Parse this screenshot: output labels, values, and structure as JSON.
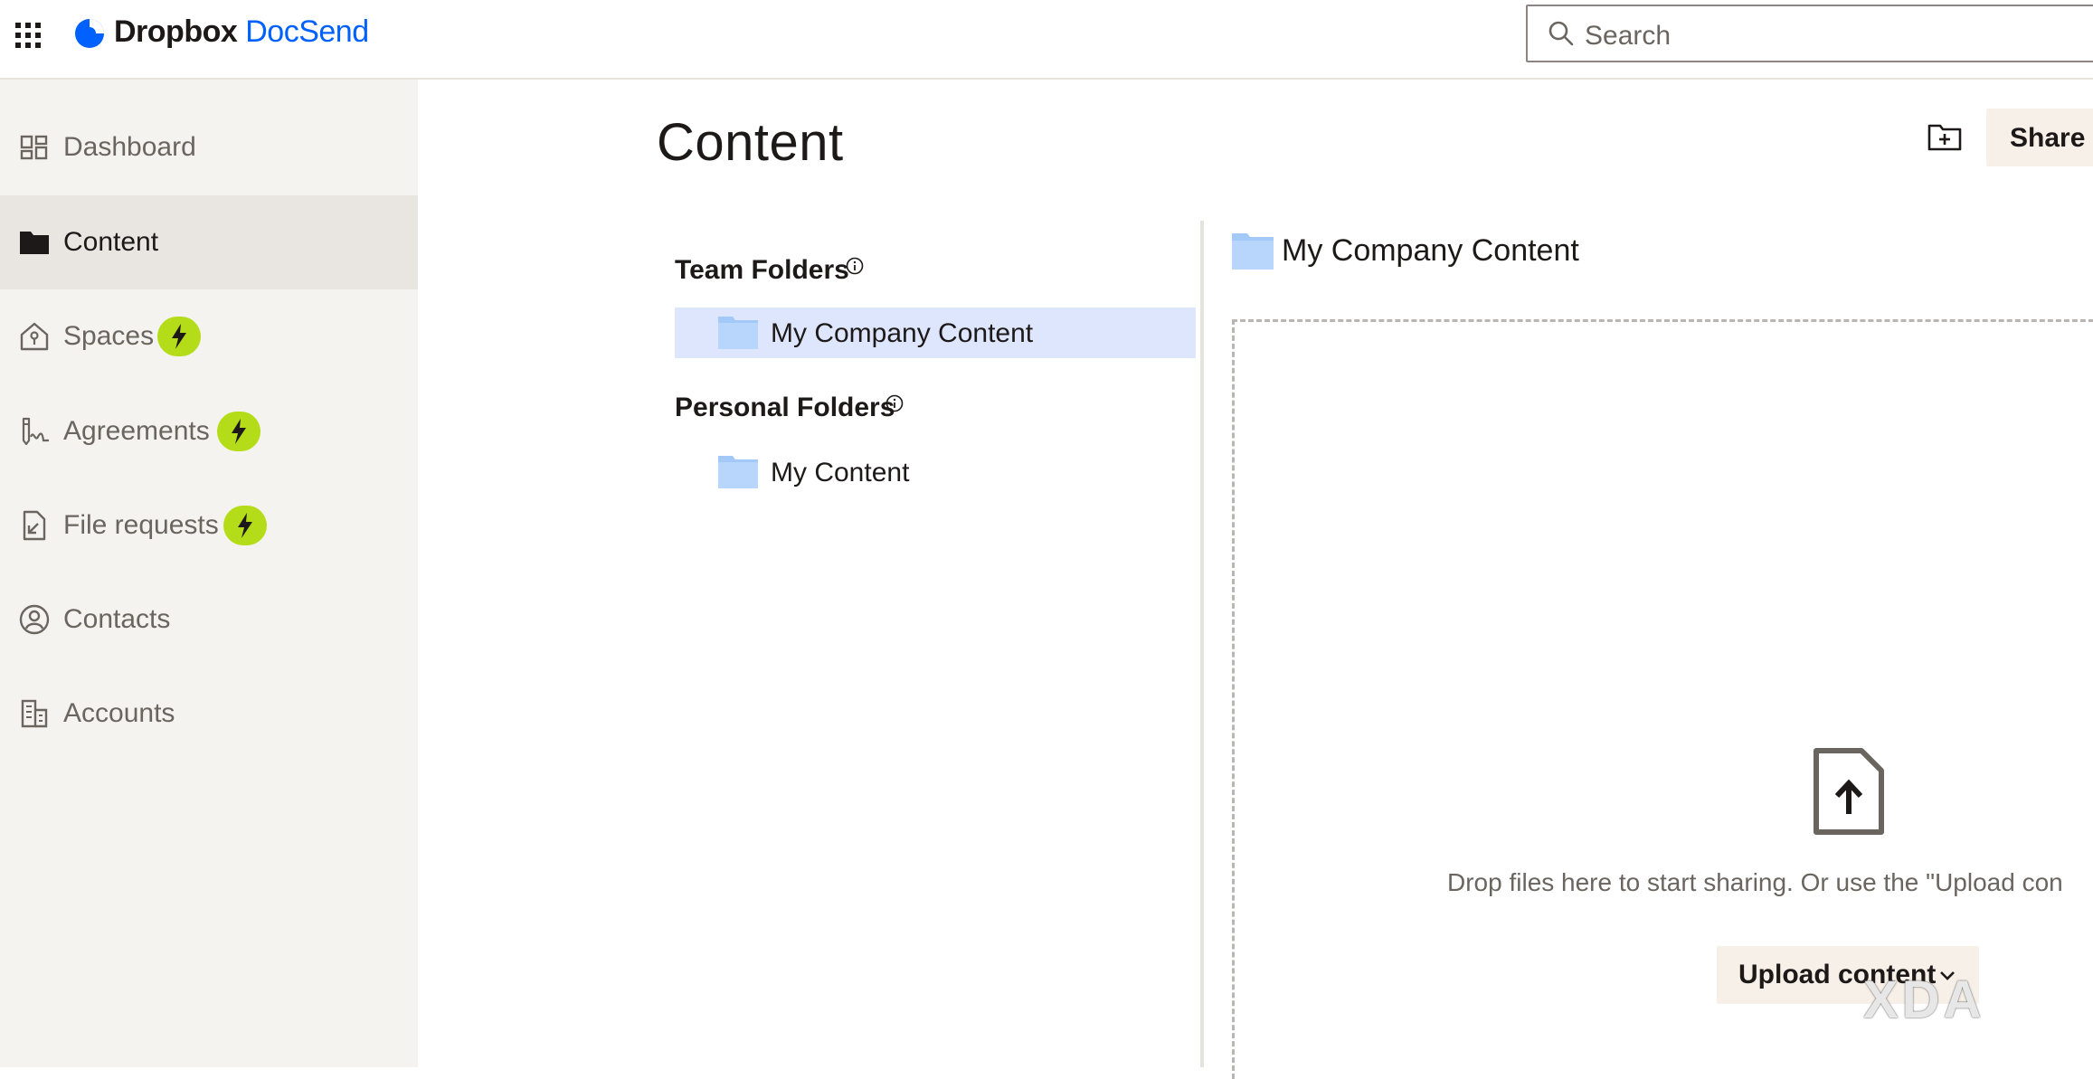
{
  "header": {
    "brand_primary": "Dropbox",
    "brand_secondary": "DocSend",
    "search_placeholder": "Search"
  },
  "sidebar": {
    "items": [
      {
        "label": "Dashboard",
        "icon": "dashboard-icon",
        "active": false,
        "upgrade_badge": false
      },
      {
        "label": "Content",
        "icon": "folder-icon",
        "active": true,
        "upgrade_badge": false
      },
      {
        "label": "Spaces",
        "icon": "spaces-icon",
        "active": false,
        "upgrade_badge": true
      },
      {
        "label": "Agreements",
        "icon": "signature-icon",
        "active": false,
        "upgrade_badge": true
      },
      {
        "label": "File requests",
        "icon": "file-request-icon",
        "active": false,
        "upgrade_badge": true
      },
      {
        "label": "Contacts",
        "icon": "contact-icon",
        "active": false,
        "upgrade_badge": false
      },
      {
        "label": "Accounts",
        "icon": "building-icon",
        "active": false,
        "upgrade_badge": false
      }
    ]
  },
  "main": {
    "title": "Content",
    "share_label": "Share C",
    "team_folders_heading": "Team Folders",
    "team_folders": [
      "My Company Content"
    ],
    "personal_folders_heading": "Personal Folders",
    "personal_folders": [
      "My Content"
    ],
    "panel_title": "My Company Content",
    "drop_text": "Drop files here to start sharing. Or use the \"Upload con",
    "upload_label": "Upload content"
  },
  "watermark": "XDA",
  "colors": {
    "brand_blue": "#0061fe",
    "bolt_green": "#b4dc19",
    "selected_bg": "#dde6fd",
    "sidebar_bg": "#f5f3ef",
    "folder_blue": "#a3c9f9",
    "button_bg": "#f7f0e8"
  }
}
